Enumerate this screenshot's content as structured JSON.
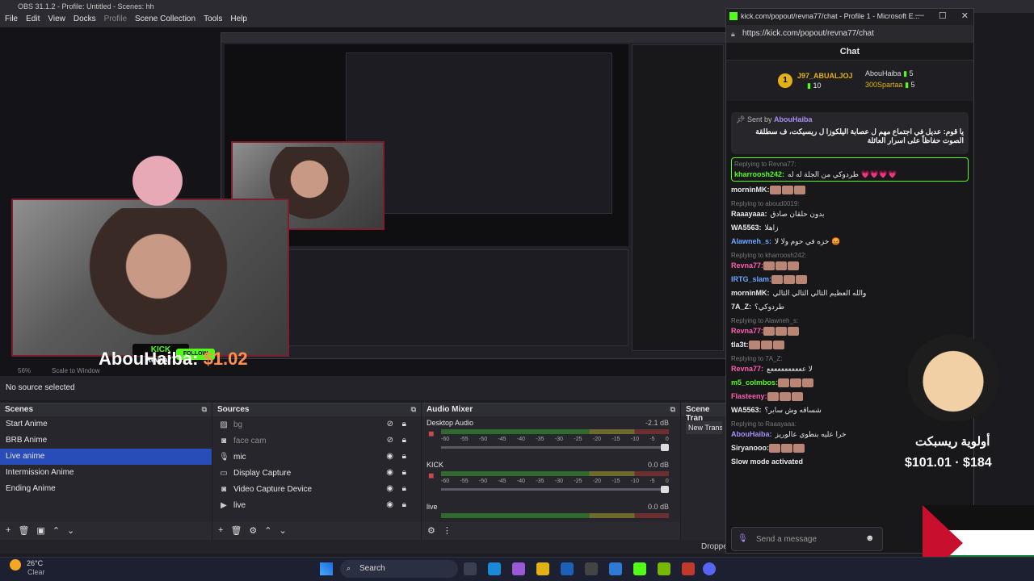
{
  "obs": {
    "title": "OBS 31.1.2 - Profile: Untitled - Scenes: hh",
    "menu": [
      "File",
      "Edit",
      "View",
      "Docks",
      "Profile",
      "Scene Collection",
      "Tools",
      "Help"
    ],
    "zoom": "56%",
    "scale_label": "Scale to Window",
    "no_source": "No source selected",
    "donation_name": "AbouHaiba:",
    "donation_amount": "$1.02",
    "streamer_name": "Revna77",
    "kick_label": "KICK",
    "follow_label": "FOLLOW",
    "scenes_title": "Scenes",
    "scenes": [
      "Start Anime",
      "BRB Anime",
      "Live anime",
      "Intermission Anime",
      "Ending Anime"
    ],
    "active_scene": "Live anime",
    "sources_title": "Sources",
    "sources": [
      {
        "name": "bg",
        "icon": "image-icon",
        "hidden": true
      },
      {
        "name": "face cam",
        "icon": "camera-icon",
        "hidden": true
      },
      {
        "name": "mic",
        "icon": "mic-icon",
        "hidden": false
      },
      {
        "name": "Display Capture",
        "icon": "monitor-icon",
        "hidden": false
      },
      {
        "name": "Video Capture Device",
        "icon": "camera-icon",
        "hidden": false
      },
      {
        "name": "live",
        "icon": "play-icon",
        "hidden": false
      }
    ],
    "mixer_title": "Audio Mixer",
    "mixer": [
      {
        "name": "Desktop Audio",
        "db": "-2.1 dB",
        "volume": 0.92,
        "muted": true
      },
      {
        "name": "KICK",
        "db": "0.0 dB",
        "volume": 1.0,
        "muted": true
      },
      {
        "name": "live",
        "db": "0.0 dB",
        "volume": 1.0,
        "muted": false
      }
    ],
    "meter_ticks": [
      "-60",
      "-55",
      "-50",
      "-45",
      "-40",
      "-35",
      "-30",
      "-25",
      "-20",
      "-15",
      "-10",
      "-5",
      "0"
    ],
    "transitions_title": "Scene Tran",
    "transition_value": "New Transi",
    "dropped": "Droppe"
  },
  "browser": {
    "title": "kick.com/popout/revna77/chat - Profile 1 - Microsoft E...",
    "url": "https://kick.com/popout/revna77/chat",
    "chat_header": "Chat",
    "leaderboard": {
      "rank1": {
        "name": "J97_ABUALJOJ",
        "count": "10"
      },
      "rank2": {
        "name": "AbouHaiba",
        "count": "5"
      },
      "rank3": {
        "name": "300Spartaa",
        "count": "5"
      }
    },
    "pinned": {
      "sent_by": "Sent by",
      "author": "AbouHaiba",
      "message": "يا قوم: عديل في اجتماع مهم ل عصابة اليلكوزا ل ريسيكت، ف سطلقة الصوت حفاظاً على اسرار العائلة"
    },
    "messages": [
      {
        "reply": "Replying to Revna77:",
        "user": "kharroosh242:",
        "color": "c-green",
        "text": "طردوكي من الجلة له له 💗💗💗💗",
        "highlight": true
      },
      {
        "reply": "",
        "user": "morninMK:",
        "color": "c-white",
        "text": ""
      },
      {
        "reply": "Replying to aboud0019:",
        "user": "Raaayaaa:",
        "color": "c-white",
        "text": "بدون حلقان صادق"
      },
      {
        "reply": "",
        "user": "WA5563:",
        "color": "c-white",
        "text": "زاهلا"
      },
      {
        "reply": "",
        "user": "Alawneh_s:",
        "color": "c-blue",
        "text": "خزه في حوم ولا لا 😡"
      },
      {
        "reply": "Replying to kharroosh242:",
        "user": "Revna77:",
        "color": "c-pink",
        "text": ""
      },
      {
        "reply": "",
        "user": "IRTG_slam:",
        "color": "c-blue",
        "text": ""
      },
      {
        "reply": "",
        "user": "morninMK:",
        "color": "c-white",
        "text": "والله العظيم الثالي الثالي الثالي"
      },
      {
        "reply": "",
        "user": "7A_Z:",
        "color": "c-white",
        "text": "طردوكي؟"
      },
      {
        "reply": "Replying to Alawneh_s:",
        "user": "Revna77:",
        "color": "c-pink",
        "text": ""
      },
      {
        "reply": "",
        "user": "tla3t:",
        "color": "c-white",
        "text": ""
      },
      {
        "reply": "Replying to 7A_Z:",
        "user": "Revna77:",
        "color": "c-pink",
        "text": "لا ععععععععععع"
      },
      {
        "reply": "",
        "user": "m5_colmbos:",
        "color": "c-green",
        "text": ""
      },
      {
        "reply": "",
        "user": "Flasteeny:",
        "color": "c-pink",
        "text": ""
      },
      {
        "reply": "",
        "user": "WA5563:",
        "color": "c-white",
        "text": "شساقه وش سابر؟"
      },
      {
        "reply": "Replying to Raaayaaa:",
        "user": "AbouHaiba:",
        "color": "c-purple",
        "text": "خرا عليه بنطوي عالوريز"
      },
      {
        "reply": "",
        "user": "Siryanooo:",
        "color": "c-white",
        "text": ""
      },
      {
        "reply": "",
        "user": "Slow mode activated",
        "color": "c-white",
        "text": ""
      }
    ],
    "input_placeholder": "Send a message"
  },
  "overlay": {
    "alert_text": "أولوية ريسبكت",
    "cash_text": "$101.01 · $184"
  },
  "taskbar": {
    "temp": "26°C",
    "weather": "Clear",
    "search": "Search"
  }
}
